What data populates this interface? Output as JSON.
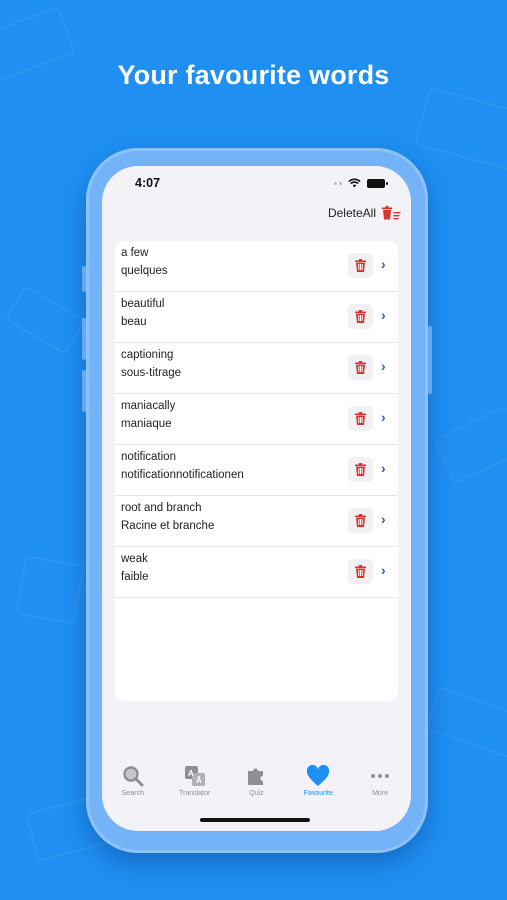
{
  "headline": "Your favourite words",
  "status": {
    "time": "4:07"
  },
  "toolbar": {
    "delete_all": "DeleteAll"
  },
  "words": [
    {
      "word": "a few",
      "translation": "quelques"
    },
    {
      "word": "beautiful",
      "translation": "beau"
    },
    {
      "word": "captioning",
      "translation": "sous-titrage"
    },
    {
      "word": "maniacally",
      "translation": "maniaque"
    },
    {
      "word": " notification",
      "translation": "notificationnotificationen"
    },
    {
      "word": "root and branch",
      "translation": "Racine et branche"
    },
    {
      "word": "weak",
      "translation": "faible"
    }
  ],
  "tabs": [
    {
      "label": "Search",
      "icon": "search-icon"
    },
    {
      "label": "Translator",
      "icon": "translator-icon"
    },
    {
      "label": "Quiz",
      "icon": "puzzle-icon"
    },
    {
      "label": "Favourite",
      "icon": "heart-icon",
      "active": true
    },
    {
      "label": "More",
      "icon": "more-icon"
    }
  ],
  "colors": {
    "background": "#1f8ff2",
    "accent": "#1f8ff2",
    "delete_red": "#e03131",
    "chevron_blue": "#2a5fc7"
  }
}
